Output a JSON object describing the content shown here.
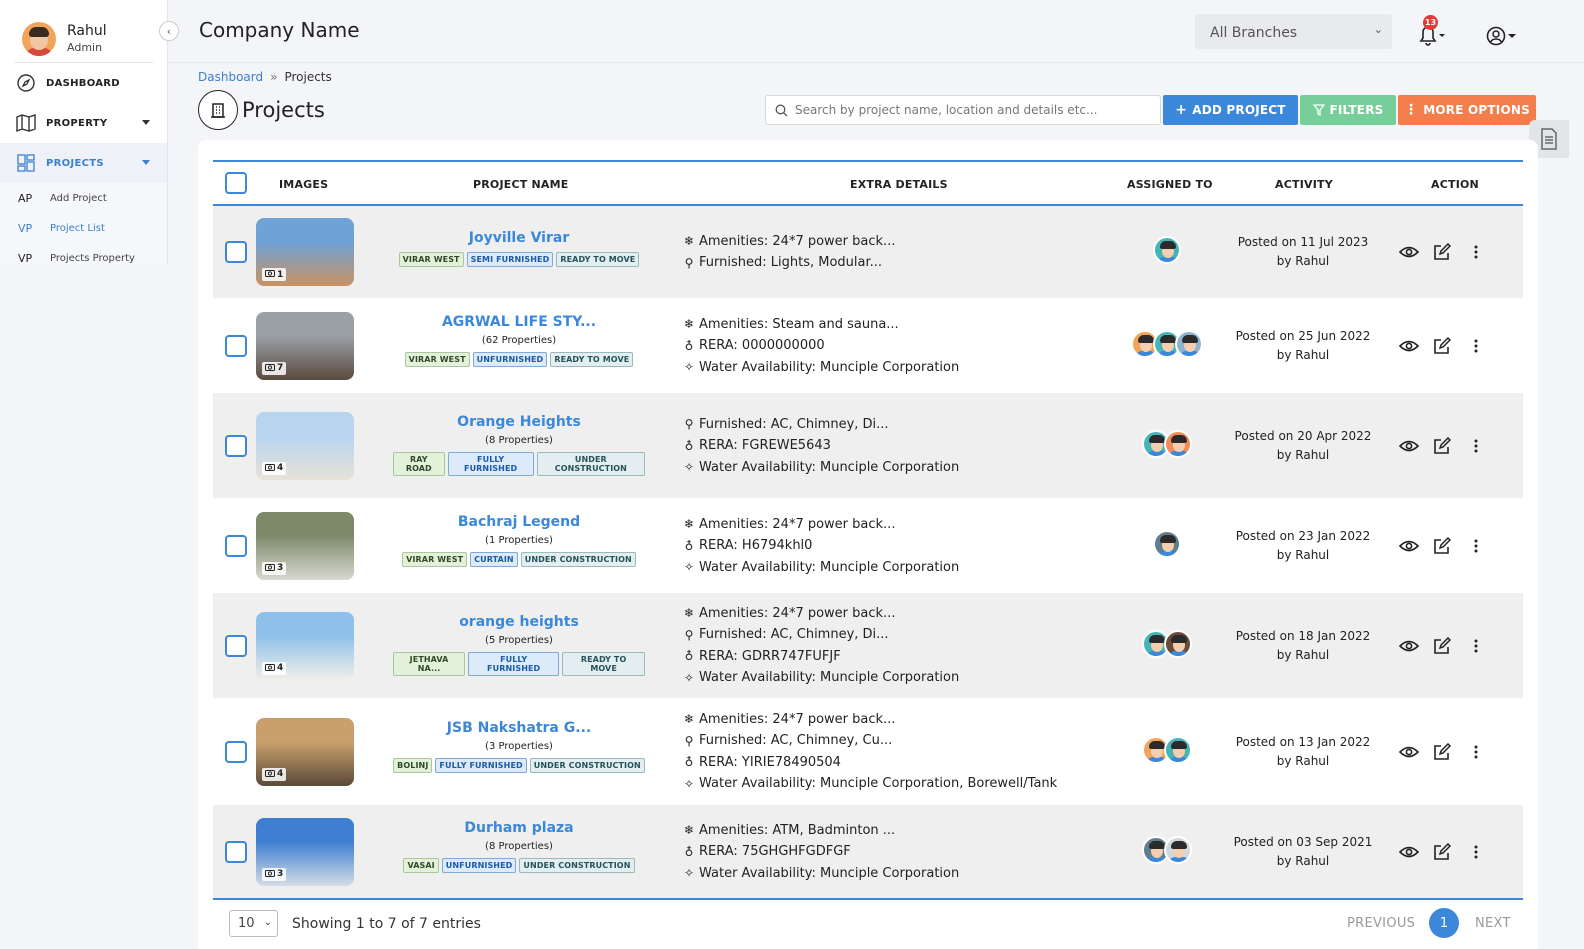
{
  "user": {
    "name": "Rahul",
    "role": "Admin"
  },
  "sidebar": {
    "items": [
      {
        "label": "DASHBOARD",
        "icon": "compass-icon"
      },
      {
        "label": "PROPERTY",
        "icon": "map-icon"
      },
      {
        "label": "PROJECTS",
        "icon": "grid-icon"
      }
    ],
    "sub_items": [
      {
        "abbr": "AP",
        "label": "Add Project"
      },
      {
        "abbr": "VP",
        "label": "Project List"
      },
      {
        "abbr": "VP",
        "label": "Projects Property"
      }
    ]
  },
  "header": {
    "company": "Company Name",
    "branch": "All Branches",
    "notification_count": "13"
  },
  "breadcrumb": {
    "home": "Dashboard",
    "sep": "»",
    "current": "Projects"
  },
  "page": {
    "title": "Projects"
  },
  "search": {
    "placeholder": "Search by project name, location and details etc..."
  },
  "toolbar": {
    "add": "ADD PROJECT",
    "filters": "FILTERS",
    "more": "MORE OPTIONS"
  },
  "table": {
    "columns": [
      "IMAGES",
      "PROJECT NAME",
      "EXTRA DETAILS",
      "ASSIGNED TO",
      "ACTIVITY",
      "ACTION"
    ],
    "rows": [
      {
        "photos": "1",
        "name": "Joyville Virar",
        "count": "",
        "tags": [
          {
            "t": "VIRAR WEST",
            "k": "loc"
          },
          {
            "t": "SEMI FURNISHED",
            "k": "fur"
          },
          {
            "t": "READY TO MOVE",
            "k": "stat"
          }
        ],
        "details": [
          {
            "i": "❄",
            "t": "Amenities: 24*7 power back..."
          },
          {
            "i": "⚲",
            "t": "Furnished: Lights, Modular..."
          }
        ],
        "posted": "Posted on 11 Jul 2023",
        "by": "by Rahul",
        "avatars": [
          "#45b5b8"
        ],
        "img": [
          "#6fa2d6",
          "#c89262"
        ]
      },
      {
        "photos": "7",
        "name": "AGRWAL LIFE STY...",
        "count": "(62 Properties)",
        "tags": [
          {
            "t": "VIRAR WEST",
            "k": "loc"
          },
          {
            "t": "UNFURNISHED",
            "k": "fur"
          },
          {
            "t": "READY TO MOVE",
            "k": "stat"
          }
        ],
        "details": [
          {
            "i": "❄",
            "t": "Amenities: Steam and sauna..."
          },
          {
            "i": "♁",
            "t": "RERA: 0000000000"
          },
          {
            "i": "✧",
            "t": "Water Availability: Munciple Corporation"
          }
        ],
        "posted": "Posted on 25 Jun 2022",
        "by": "by Rahul",
        "avatars": [
          "#f2a55a",
          "#45b5b8",
          "#8fb3cf"
        ],
        "img": [
          "#9aa0a6",
          "#5b4a3e"
        ]
      },
      {
        "photos": "4",
        "name": "Orange Heights",
        "count": "(8 Properties)",
        "tags": [
          {
            "t": "RAY ROAD",
            "k": "loc"
          },
          {
            "t": "FULLY FURNISHED",
            "k": "fur"
          },
          {
            "t": "UNDER CONSTRUCTION",
            "k": "stat"
          }
        ],
        "details": [
          {
            "i": "⚲",
            "t": "Furnished: AC, Chimney, Di..."
          },
          {
            "i": "♁",
            "t": "RERA: FGREWE5643"
          },
          {
            "i": "✧",
            "t": "Water Availability: Munciple Corporation"
          }
        ],
        "posted": "Posted on 20 Apr 2022",
        "by": "by Rahul",
        "avatars": [
          "#45b5b8",
          "#f28a5a"
        ],
        "img": [
          "#b8d4ee",
          "#e7e2d8"
        ]
      },
      {
        "photos": "3",
        "name": "Bachraj Legend",
        "count": "(1 Properties)",
        "tags": [
          {
            "t": "VIRAR WEST",
            "k": "loc"
          },
          {
            "t": "CURTAIN",
            "k": "fur"
          },
          {
            "t": "UNDER CONSTRUCTION",
            "k": "stat"
          }
        ],
        "details": [
          {
            "i": "❄",
            "t": "Amenities: 24*7 power back..."
          },
          {
            "i": "♁",
            "t": "RERA: H6794khl0"
          },
          {
            "i": "✧",
            "t": "Water Availability: Munciple Corporation"
          }
        ],
        "posted": "Posted on 23 Jan 2022",
        "by": "by Rahul",
        "avatars": [
          "#5f7d8e"
        ],
        "img": [
          "#7d8a6a",
          "#d8d8d0"
        ]
      },
      {
        "photos": "4",
        "name": "orange heights",
        "count": "(5 Properties)",
        "tags": [
          {
            "t": "JETHAVA NA...",
            "k": "loc"
          },
          {
            "t": "FULLY FURNISHED",
            "k": "fur"
          },
          {
            "t": "READY TO MOVE",
            "k": "stat"
          }
        ],
        "details": [
          {
            "i": "❄",
            "t": "Amenities: 24*7 power back..."
          },
          {
            "i": "⚲",
            "t": "Furnished: AC, Chimney, Di..."
          },
          {
            "i": "♁",
            "t": "RERA: GDRR747FUFJF"
          },
          {
            "i": "✧",
            "t": "Water Availability: Munciple Corporation"
          }
        ],
        "posted": "Posted on 18 Jan 2022",
        "by": "by Rahul",
        "avatars": [
          "#45b5b8",
          "#6b4a3a"
        ],
        "img": [
          "#8fc0ea",
          "#f1efe8"
        ]
      },
      {
        "photos": "4",
        "name": "JSB Nakshatra G...",
        "count": "(3 Properties)",
        "tags": [
          {
            "t": "BOLINJ",
            "k": "loc"
          },
          {
            "t": "FULLY FURNISHED",
            "k": "fur"
          },
          {
            "t": "UNDER CONSTRUCTION",
            "k": "stat"
          }
        ],
        "details": [
          {
            "i": "❄",
            "t": "Amenities: 24*7 power back..."
          },
          {
            "i": "⚲",
            "t": "Furnished: AC, Chimney, Cu..."
          },
          {
            "i": "♁",
            "t": "RERA: YIRIE78490504"
          },
          {
            "i": "✧",
            "t": "Water Availability: Munciple Corporation, Borewell/Tank"
          }
        ],
        "posted": "Posted on 13 Jan 2022",
        "by": "by Rahul",
        "avatars": [
          "#f2a55a",
          "#45b5b8"
        ],
        "img": [
          "#c9a06b",
          "#5a4a3a"
        ]
      },
      {
        "photos": "3",
        "name": "Durham plaza",
        "count": "(8 Properties)",
        "tags": [
          {
            "t": "VASAI",
            "k": "loc"
          },
          {
            "t": "UNFURNISHED",
            "k": "fur"
          },
          {
            "t": "UNDER CONSTRUCTION",
            "k": "stat"
          }
        ],
        "details": [
          {
            "i": "❄",
            "t": "Amenities: ATM, Badminton ..."
          },
          {
            "i": "♁",
            "t": "RERA: 75GHGHFGDFGF"
          },
          {
            "i": "✧",
            "t": "Water Availability: Munciple Corporation"
          }
        ],
        "posted": "Posted on 03 Sep 2021",
        "by": "by Rahul",
        "avatars": [
          "#5f7d8e",
          "#cfd8dc"
        ],
        "img": [
          "#3f7fd1",
          "#d6dde6"
        ]
      }
    ]
  },
  "footer": {
    "per_page": "10",
    "showing": "Showing 1 to 7 of 7 entries",
    "previous": "PREVIOUS",
    "page": "1",
    "next": "NEXT"
  }
}
